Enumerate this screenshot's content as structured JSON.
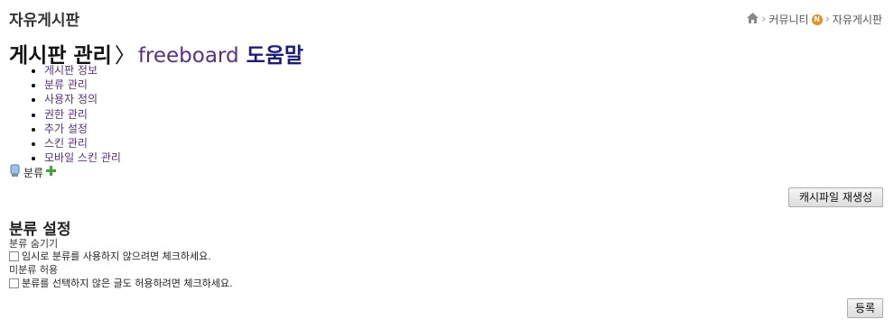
{
  "board_title": "자유게시판",
  "breadcrumb": {
    "home_icon": "home-icon",
    "community": "커뮤니티",
    "badge": "N",
    "current": "자유게시판"
  },
  "heading": {
    "crumb": "게시판 관리",
    "separator": "〉",
    "module": "freeboard",
    "help": "도움말"
  },
  "menu": {
    "items": [
      "게시판 정보",
      "분류 관리",
      "사용자 정의",
      "권한 관리",
      "추가 설정",
      "스킨 관리",
      "모바일 스킨 관리"
    ]
  },
  "category": {
    "label": "분류",
    "add_icon": "plus-icon"
  },
  "buttons": {
    "cache_regenerate": "캐시파일 재생성",
    "submit": "등록"
  },
  "settings": {
    "title": "분류 설정",
    "hide_label": "분류 숨기기",
    "hide_desc": "임시로 분류를 사용하지 않으려면 체크하세요.",
    "allow_label": "미분류 허용",
    "allow_desc": "분류를 선택하지 않은 글도 허용하려면 체크하세요."
  },
  "colors": {
    "link": "#5a2d91",
    "help": "#1a1a8c",
    "badge": "#f08a1c"
  }
}
